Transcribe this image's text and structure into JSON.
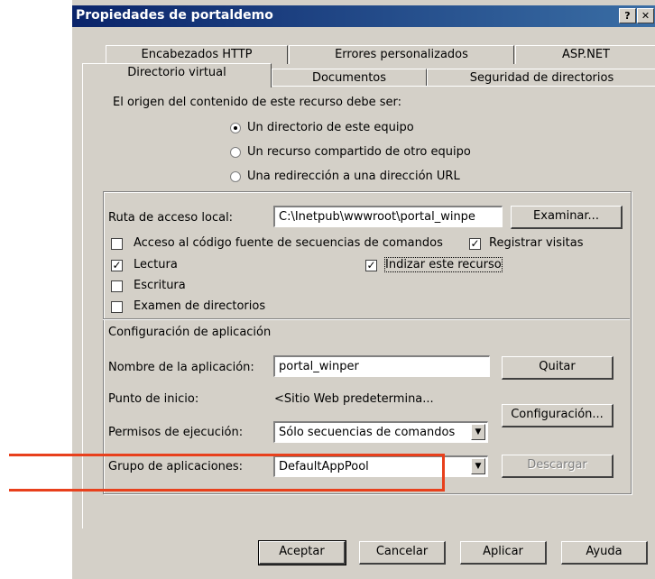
{
  "window": {
    "title": "Propiedades de portaldemo",
    "help_btn": "?",
    "close_btn": "✕"
  },
  "tabs_row1": [
    "Encabezados HTTP",
    "Errores personalizados",
    "ASP.NET"
  ],
  "tabs_row2": [
    "Directorio virtual",
    "Documentos",
    "Seguridad de directorios"
  ],
  "content": {
    "origin_label": "El origen del contenido de este recurso debe ser:",
    "radio1": "Un directorio de este equipo",
    "radio2": "Un recurso compartido de otro equipo",
    "radio3": "Una redirección a una dirección URL",
    "local_path_label": "Ruta de acceso local:",
    "local_path_value": "C:\\Inetpub\\wwwroot\\portal_winpe",
    "browse_btn": "Examinar...",
    "check_script_source": "Acceso al código fuente de secuencias de comandos",
    "check_log": "Registrar visitas",
    "check_read": "Lectura",
    "check_index": "Indizar este recurso",
    "check_write": "Escritura",
    "check_browse": "Examen de directorios",
    "app_config_label": "Configuración de aplicación",
    "app_name_label": "Nombre de la aplicación:",
    "app_name_value": "portal_winper",
    "remove_btn": "Quitar",
    "start_point_label": "Punto de inicio:",
    "start_point_value": "<Sitio Web predetermina...",
    "config_btn": "Configuración...",
    "exec_perm_label": "Permisos de ejecución:",
    "exec_perm_value": "Sólo secuencias de comandos",
    "app_pool_label": "Grupo de aplicaciones:",
    "app_pool_value": "DefaultAppPool",
    "unload_btn": "Descargar"
  },
  "footer": {
    "ok": "Aceptar",
    "cancel": "Cancelar",
    "apply": "Aplicar",
    "help": "Ayuda"
  },
  "colors": {
    "highlight": "#e8401c",
    "titlebar": "#0a246a",
    "face": "#d4d0c8"
  }
}
